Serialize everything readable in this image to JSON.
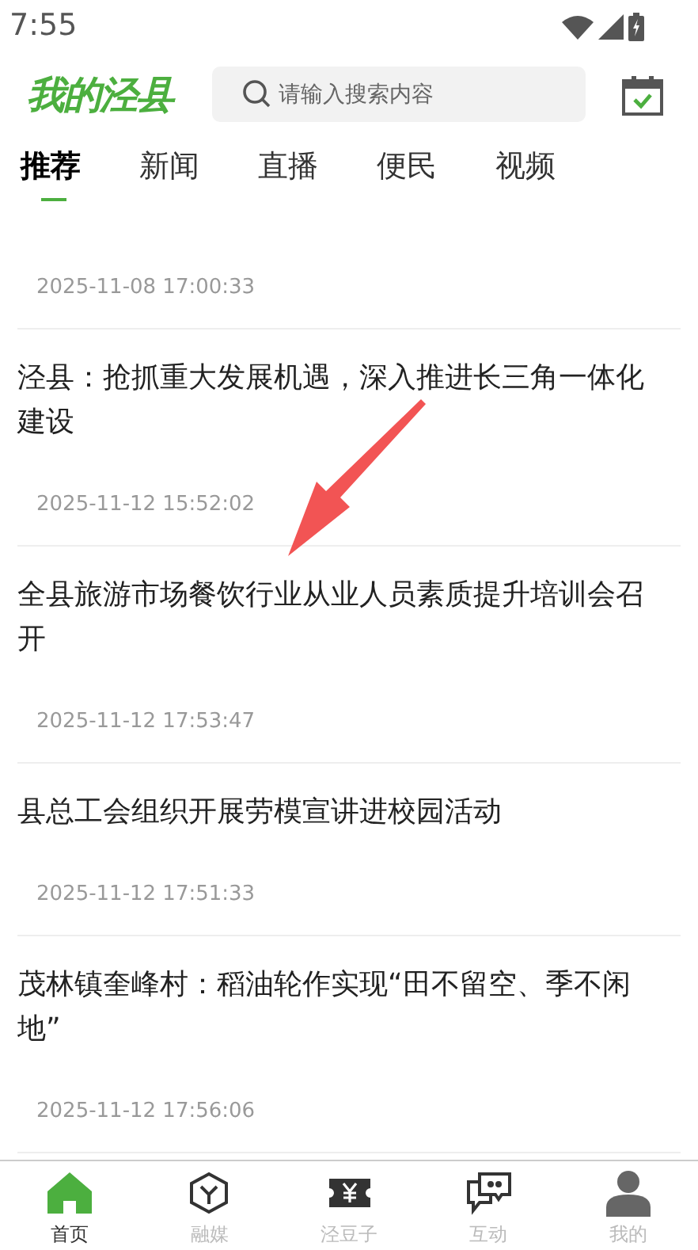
{
  "status_bar": {
    "time": "7:55"
  },
  "header": {
    "logo": "我的泾县",
    "search": {
      "placeholder": "请输入搜索内容"
    }
  },
  "tabs": [
    {
      "label": "推荐",
      "selected": true
    },
    {
      "label": "新闻",
      "selected": false
    },
    {
      "label": "直播",
      "selected": false
    },
    {
      "label": "便民",
      "selected": false
    },
    {
      "label": "视频",
      "selected": false
    }
  ],
  "articles": [
    {
      "date": "2025-11-08 17:00:33"
    },
    {
      "title": "泾县：抢抓重大发展机遇，深入推进长三角一体化建设",
      "date": "2025-11-12 15:52:02"
    },
    {
      "title": "全县旅游市场餐饮行业从业人员素质提升培训会召开",
      "date": "2025-11-12 17:53:47"
    },
    {
      "title": "县总工会组织开展劳模宣讲进校园活动",
      "date": "2025-11-12 17:51:33"
    },
    {
      "title": "茂林镇奎峰村：稻油轮作实现“田不留空、季不闲地”",
      "date": "2025-11-12 17:56:06"
    }
  ],
  "bottom_nav": [
    {
      "label": "首页",
      "kind": "home",
      "selected": true
    },
    {
      "label": "融媒",
      "kind": "cube",
      "selected": false
    },
    {
      "label": "泾豆子",
      "kind": "ticket",
      "selected": false
    },
    {
      "label": "互动",
      "kind": "chat",
      "selected": false
    },
    {
      "label": "我的",
      "kind": "person",
      "selected": false
    }
  ]
}
